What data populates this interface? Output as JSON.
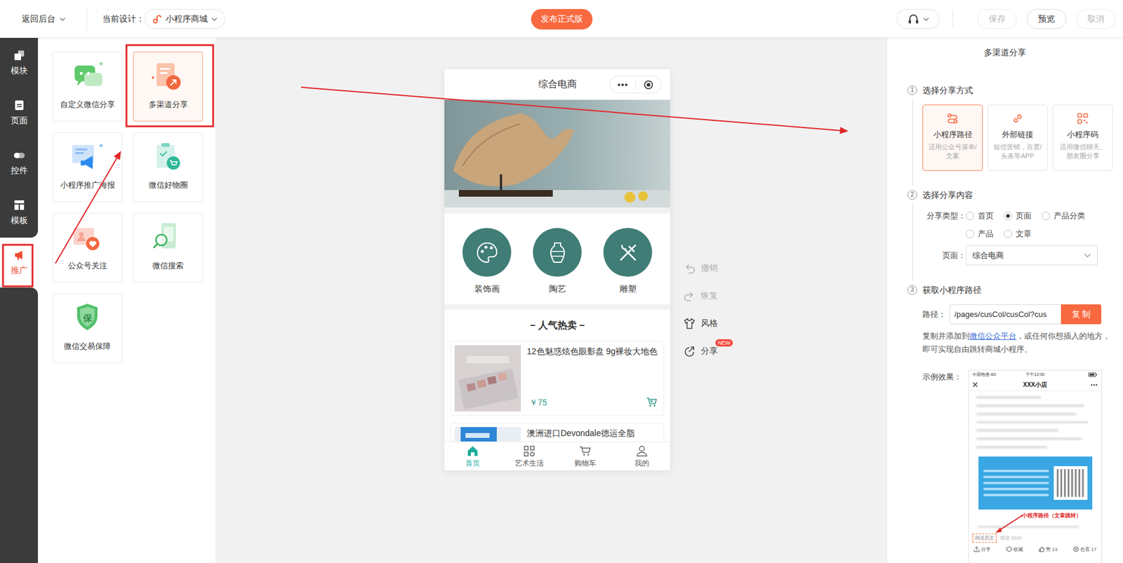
{
  "header": {
    "back": "返回后台",
    "current_label": "当前设计：",
    "design": "小程序商城",
    "publish": "发布正式版",
    "actions": [
      {
        "label": "保存",
        "disabled": true
      },
      {
        "label": "预览",
        "disabled": false
      },
      {
        "label": "取消",
        "disabled": true
      }
    ]
  },
  "sidebar": {
    "items": [
      {
        "label": "模块",
        "selected": false
      },
      {
        "label": "页面",
        "selected": false
      },
      {
        "label": "控件",
        "selected": false
      },
      {
        "label": "模板",
        "selected": false
      },
      {
        "label": "推广",
        "selected": true
      }
    ]
  },
  "components": [
    {
      "label": "自定义微信分享",
      "selected": false
    },
    {
      "label": "多渠道分享",
      "selected": true
    },
    {
      "label": "小程序推广海报",
      "selected": false
    },
    {
      "label": "微信好物圈",
      "selected": false
    },
    {
      "label": "公众号关注",
      "selected": false
    },
    {
      "label": "微信搜索",
      "selected": false
    },
    {
      "label": "微信交易保障",
      "selected": false,
      "icon_text": "保"
    }
  ],
  "phone": {
    "title": "综合电商",
    "categories": [
      {
        "label": "装饰画"
      },
      {
        "label": "陶艺"
      },
      {
        "label": "雕塑"
      }
    ],
    "section_title": "– 人气热卖 –",
    "products": [
      {
        "name": "12色魅惑炫色眼影盘 9g裸妆大地色",
        "price": "￥75"
      },
      {
        "name": "澳洲进口Devondale德运全脂"
      }
    ],
    "tabs": [
      {
        "label": "首页",
        "selected": true
      },
      {
        "label": "艺术生活",
        "selected": false
      },
      {
        "label": "购物车",
        "selected": false
      },
      {
        "label": "我的",
        "selected": false
      }
    ]
  },
  "tools": [
    {
      "label": "撤销",
      "disabled": true
    },
    {
      "label": "恢复",
      "disabled": true
    },
    {
      "label": "风格",
      "disabled": false
    },
    {
      "label": "分享",
      "disabled": false,
      "badge": "NEW"
    }
  ],
  "panel": {
    "title": "多渠道分享",
    "step1": {
      "num": "1",
      "title": "选择分享方式",
      "options": [
        {
          "title": "小程序路径",
          "desc": "适用公众号菜单/文案",
          "selected": true
        },
        {
          "title": "外部链接",
          "desc": "短信营销，百度/头条等APP",
          "selected": false
        },
        {
          "title": "小程序码",
          "desc": "适用微信聊天、朋友圈分享",
          "selected": false
        }
      ]
    },
    "step2": {
      "num": "2",
      "title": "选择分享内容",
      "type_label": "分享类型：",
      "types": [
        {
          "label": "首页",
          "selected": false
        },
        {
          "label": "页面",
          "selected": true
        },
        {
          "label": "产品分类",
          "selected": false
        },
        {
          "label": "产品",
          "selected": false
        },
        {
          "label": "文章",
          "selected": false
        }
      ],
      "page_label": "页面：",
      "page_value": "综合电商"
    },
    "step3": {
      "num": "3",
      "title": "获取小程序路径",
      "path_label": "路径：",
      "path_value": "/pages/cusCol/cusCol?cus",
      "copy": "复 制",
      "desc_before": "复制并添加到",
      "desc_link": "微信公众平台",
      "desc_after": "，或任何你想插入的地方，即可实现自由跳转商城小程序。",
      "example_label": "示例效果："
    },
    "example": {
      "carrier": "中国电信 4G",
      "time": "下午12:00",
      "title": "XXX小店",
      "callout": "小程序路径（文章跳转）",
      "read_original": "阅读原文",
      "reads": "阅读 5330",
      "actions": [
        {
          "label": "分享"
        },
        {
          "label": "收藏"
        },
        {
          "label": "赞 13"
        },
        {
          "label": "在看 17"
        }
      ]
    }
  }
}
